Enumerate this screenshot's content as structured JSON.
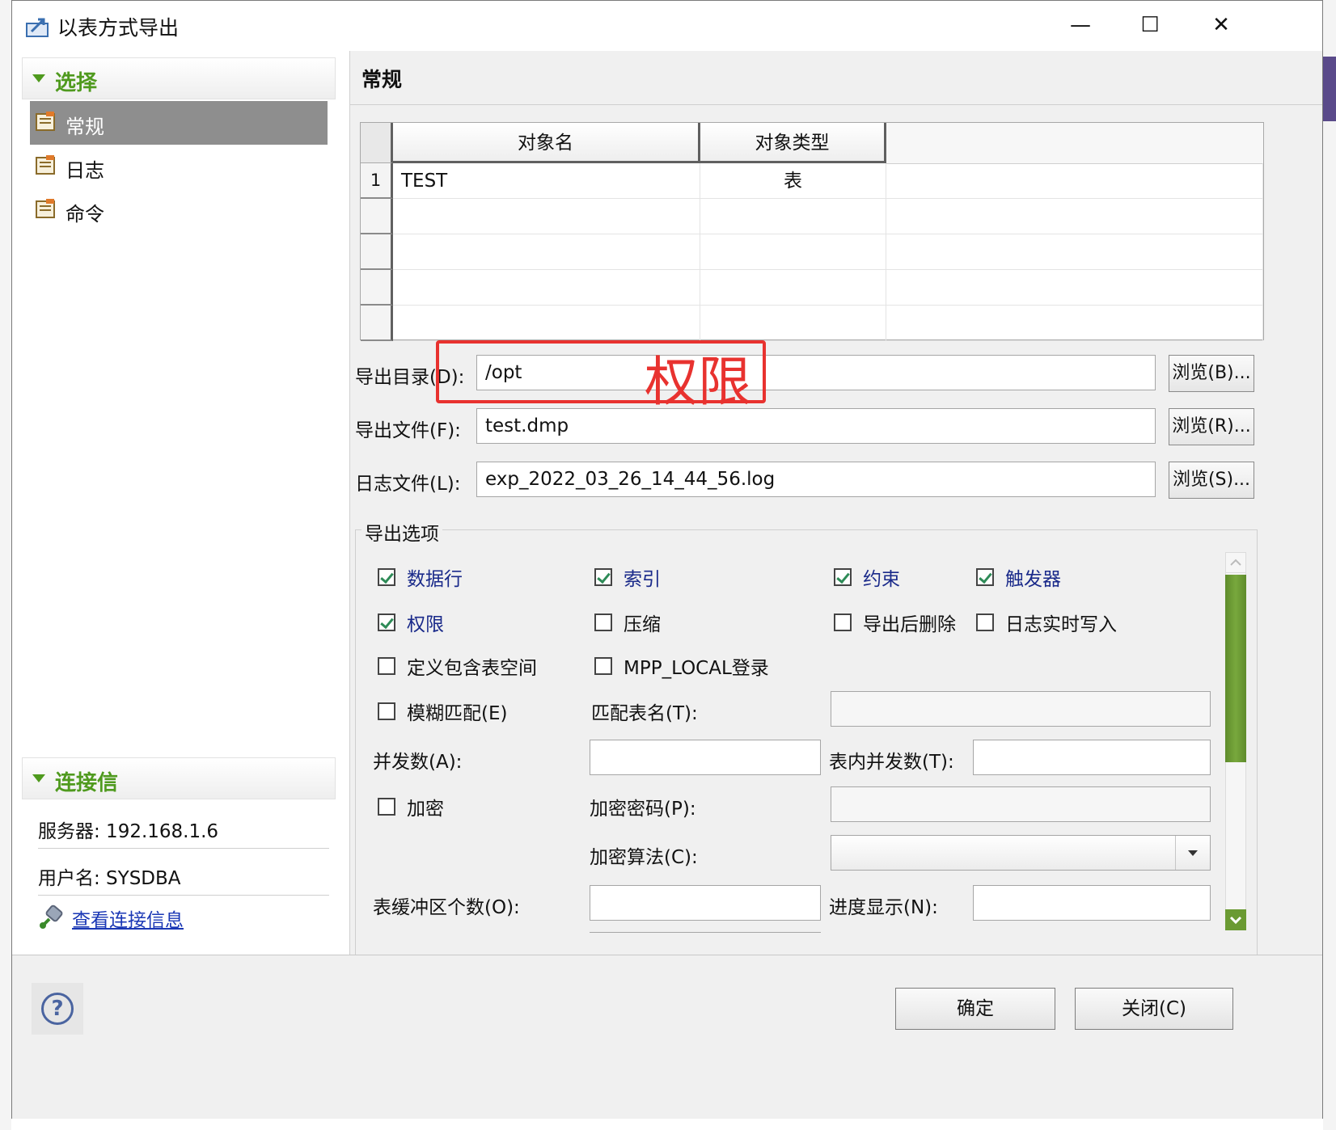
{
  "window": {
    "title": "以表方式导出",
    "minimize": "—",
    "maximize": "☐",
    "close": "✕"
  },
  "left": {
    "select_section": "选择",
    "nav": [
      {
        "label": "常规",
        "selected": true
      },
      {
        "label": "日志",
        "selected": false
      },
      {
        "label": "命令",
        "selected": false
      }
    ],
    "conn_section": "连接信",
    "server": "服务器: 192.168.1.6",
    "user": "用户名: SYSDBA",
    "view_conn": "查看连接信息"
  },
  "right": {
    "header": "常规",
    "grid": {
      "columns": [
        "对象名",
        "对象类型"
      ],
      "rows": [
        {
          "num": "1",
          "name": "TEST",
          "type": "表"
        },
        {
          "num": "",
          "name": "",
          "type": ""
        },
        {
          "num": "",
          "name": "",
          "type": ""
        },
        {
          "num": "",
          "name": "",
          "type": ""
        },
        {
          "num": "",
          "name": "",
          "type": ""
        }
      ]
    },
    "export_dir_label": "导出目录(D):",
    "export_dir_value": "/opt",
    "export_file_label": "导出文件(F):",
    "export_file_value": "test.dmp",
    "log_file_label": "日志文件(L):",
    "log_file_value": "exp_2022_03_26_14_44_56.log",
    "browse_b": "浏览(B)...",
    "browse_r": "浏览(R)...",
    "browse_s": "浏览(S)...",
    "annotation": "权限",
    "options_title": "导出选项",
    "options": {
      "rows": "数据行",
      "index": "索引",
      "constraint": "约束",
      "trigger": "触发器",
      "privilege": "权限",
      "compress": "压缩",
      "delete_after": "导出后删除",
      "log_realtime": "日志实时写入",
      "tablespace": "定义包含表空间",
      "mpp_local": "MPP_LOCAL登录",
      "fuzzy": "模糊匹配(E)",
      "match_table": "匹配表名(T):",
      "parallel": "并发数(A):",
      "table_parallel": "表内并发数(T):",
      "encrypt": "加密",
      "encrypt_pwd": "加密密码(P):",
      "encrypt_algo": "加密算法(C):",
      "buffer_count": "表缓冲区个数(O):",
      "progress": "进度显示(N):"
    },
    "checked": {
      "rows": true,
      "index": true,
      "constraint": true,
      "trigger": true,
      "privilege": true,
      "compress": false,
      "delete_after": false,
      "log_realtime": false,
      "tablespace": false,
      "mpp_local": false,
      "fuzzy": false,
      "encrypt": false
    }
  },
  "footer": {
    "ok": "确定",
    "close": "关闭(C)",
    "help": "?"
  }
}
